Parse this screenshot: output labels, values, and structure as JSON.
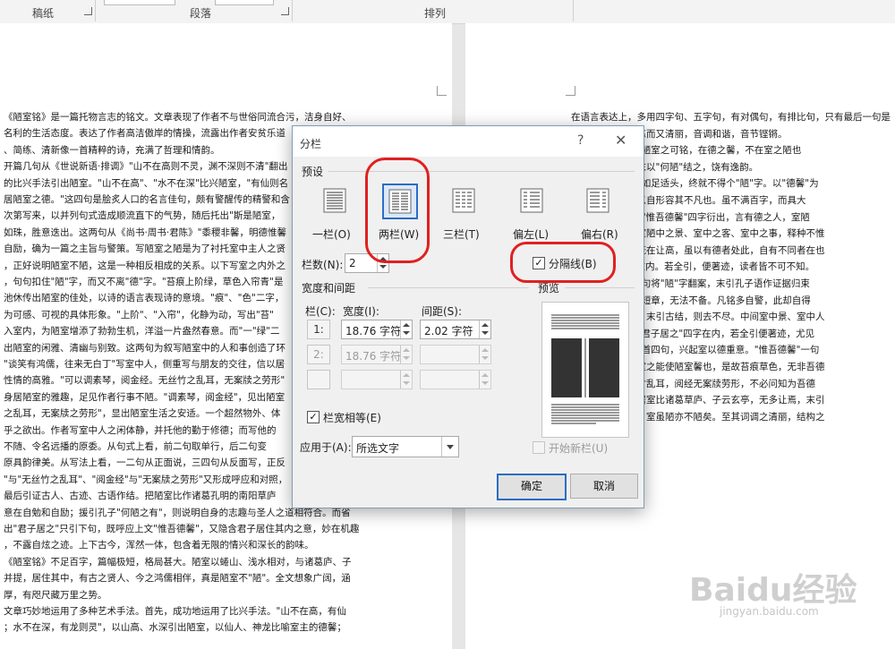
{
  "ribbon": {
    "group_left": "稿纸",
    "group_paragraph": "段落",
    "group_arrange": "排列"
  },
  "left_page_lines": [
    "《陋室铭》是一篇托物言志的铭文。文章表现了作者不与世俗同流合污，洁身自好、",
    "名利的生活态度。表达了作者高洁傲岸的情操，流露出作者安贫乐道",
    "、简练、清新像一首精粹的诗，充满了哲理和情韵。",
    "开篇几句从《世说新语·排调》\"山不在高则不灵，渊不深则不清\"翻出",
    "的比兴手法引出陋室。\"山不在高\"、\"水不在深\"比兴陋室，\"有仙则名",
    "居陋室之德。\"这四句是脍炙人口的名言佳句，颇有警醒传的精警和含",
    "次第写来，以并列句式造成顺流直下的气势，随后托出\"斯是陋室，",
    "如珠，胜意迭出。这两句从《尚书·周书·君陈》\"黍稷非馨，明德惟馨",
    "自励，确为一篇之主旨与警策。写陋室之陋是为了衬托室中主人之贤",
    "，正好说明陋室不陋，这是一种相反相成的关系。以下写室之内外之",
    "，句句扣住\"陋\"字，而又不离\"德\"字。\"苔痕上阶绿，草色入帘青\"是",
    "池休传出陋室的佳处，以诗的语言表现诗的意境。\"痕\"、\"色\"二字，",
    "为可感、可视的具体形象。\"上阶\"、\"入帘\"，化静为动，写出\"苔\"",
    "入室内，为陋室增添了勃勃生机，洋溢一片盎然春意。而\"一\"绿\"二",
    "出陋室的闲雅、清幽与别致。这两句为叙写陋室中的人和事创造了环",
    "\"谈笑有鸿儒，往来无白丁\"写室中人，侧重写与朋友的交往，信以居",
    "性情的高雅。\"可以调素琴，阅金经。无丝竹之乱耳，无案牍之劳形\"",
    "身居陋室的雅趣，足见作者行事不陋。\"调素琴，阅金经\"，见出陋室",
    "之乱耳，无案牍之劳形\"，显出陋室生活之安适。一个超然物外、体",
    "乎之欲出。作者写室中人之闲体静，并托他的勤于修德；而写他的",
    "不随、令名远播的原委。从句式上看，前二句取单行，后二句变",
    "原具韵律美。从写法上看，一二句从正面说，三四句从反面写，正反",
    "\"与\"无丝竹之乱耳\"、\"阅金经\"与\"无案牍之劳形\"又形成呼应和对照，",
    "最后引证古人、古迹、古语作结。把陋室比作诸葛孔明的南阳草庐",
    "意在自勉和自励；援引孔子\"何陋之有\"，则说明自身的志趣与圣人之道相符合。而省",
    "出\"君子居之\"只引下句，既呼应上文\"惟吾德馨\"，又隐含君子居住其内之意，妙在机趣",
    "，不露自炫之迹。上下古今，浑然一体，包含着无限的情兴和深长的韵味。",
    "《陋室铭》不足百字，篇幅极短，格局甚大。陋室以蜷山、浅水相对，与诸葛庐、子",
    "并提，居住其中，有古之贤人、今之鸿儒相伴，真是陋室不\"陋\"。全文想象广阔，涵",
    "厚，有咫尺藏万里之势。",
    "文章巧妙地运用了多种艺术手法。首先，成功地运用了比兴手法。\"山不在高，有仙",
    "；水不在深，有龙则灵\"，以山高、水深引出陋室，以仙人、神龙比喻室主的德馨；"
  ],
  "right_page_lines": [
    "在语言表达上，多用四字句、五字句，有对偶句，有排比句，只有最后一句是",
    "于变化，文字精练而又清丽，音调和谐，音节铿锵。",
    "析《古文观止》：陋室之可铭，在德之馨，不在室之陋也",
    "醒目首成佳歇。末以\"何陋\"结之，饶有逸韵。",
    "赏者》：陋室但称如足适头，终就不得个\"陋\"字。以\"德馨\"为",
    "此文独借室之陋以自形容其不凡也。虽不满百字，而具大",
    "折义》：通篇总是\"惟吾德馨\"四字衍出，言有德之人，室陋",
    "以山水喻入，故室陋中之景、室中之客、室中之事，释种不惟",
    "亭、西蜀玄亭，既在让高，虽以有德者处此，自有不同者在也",
    "\"君子居之\"四字在内。若全引，便著迹，读者皆不可不知。",
    "文评注全集》：句句将\"陋\"字翻案，末引孔子语作证据归束",
    "案语览篇》：小小短章，无法不备。凡铭多自警，此却自得",
    "句引，则来不突；末引古结，则去不尽。中间室中景、室中人",
    "何陋之有，隐藏\"君子居之\"四字在内，若全引便著迹，尤见",
    "文释义新编》：起首四句，兴起室以德重意。\"惟吾德馨\"一句",
    "类、以下皆言陋室之能使陋室馨也，是故苔痕草色，无非吾德",
    "应鹏、调琴无丝竹乱耳，阅经无案牍劳形，不必问知为吾德",
    "德者如是，虽以居室比诸葛草庐、子云玄亭，无多让焉，末引",
    "亦德又何可量耶？室虽陋亦不陋矣。至其词调之清丽，结构之",
    "为大雅。"
  ],
  "dialog": {
    "title": "分栏",
    "help_glyph": "?",
    "close_glyph": "✕",
    "presets_heading": "预设",
    "presets": [
      "一栏(O)",
      "两栏(W)",
      "三栏(T)",
      "偏左(L)",
      "偏右(R)"
    ],
    "num_columns_label": "栏数(N):",
    "num_columns_value": "2",
    "separator_label": "分隔线(B)",
    "separator_checked": true,
    "width_spacing_heading": "宽度和间距",
    "col_header": "栏(C):",
    "width_header": "宽度(I):",
    "spacing_header": "间距(S):",
    "rows": [
      {
        "num": "1:",
        "width": "18.76 字符",
        "spacing": "2.02 字符",
        "enabled": true
      },
      {
        "num": "2:",
        "width": "18.76 字符",
        "spacing": "",
        "enabled": false
      },
      {
        "num": "",
        "width": "",
        "spacing": "",
        "enabled": false
      }
    ],
    "equal_width_label": "栏宽相等(E)",
    "equal_width_checked": true,
    "preview_heading": "预览",
    "apply_to_label": "应用于(A):",
    "apply_to_value": "所选文字",
    "new_column_label": "开始新栏(U)",
    "new_column_checked": false,
    "ok_label": "确定",
    "cancel_label": "取消",
    "check_glyph": "✓"
  },
  "watermark": {
    "brand": "Baidu经验",
    "url": "jingyan.baidu.com"
  },
  "colors": {
    "accent": "#2b6cc4",
    "annotation_red": "#e02020",
    "dialog_bg": "#f0f0f0"
  }
}
